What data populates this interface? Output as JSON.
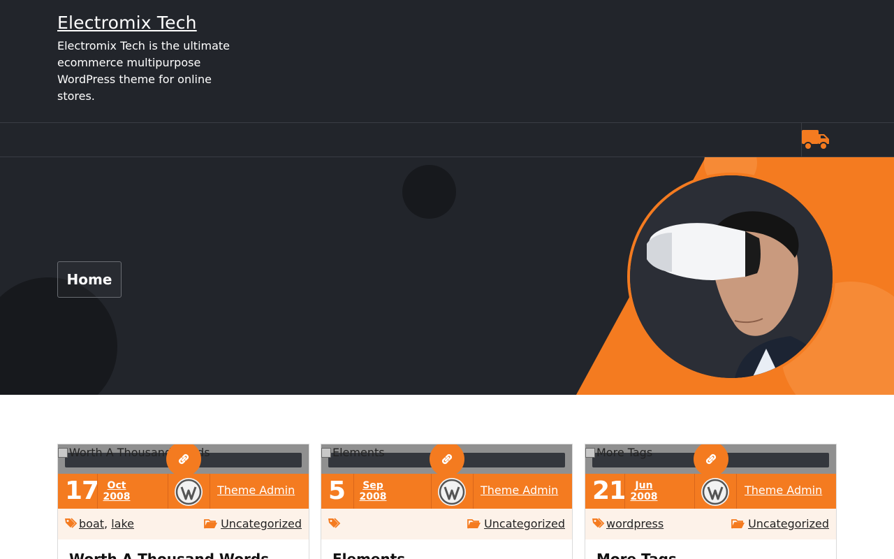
{
  "header": {
    "site_title": "Electromix Tech",
    "site_description": "Electromix Tech is the ultimate ecommerce multipurpose WordPress theme for online stores."
  },
  "nav": {
    "truck_icon": "truck-icon"
  },
  "hero": {
    "home_label": "Home"
  },
  "colors": {
    "accent": "#f47b20",
    "dark": "#22252b"
  },
  "posts": [
    {
      "thumb_alt": "Worth A Thousand Words",
      "day": "17",
      "month": "Oct",
      "year": "2008",
      "author": "Theme Admin",
      "tags": [
        "boat",
        "lake"
      ],
      "category": "Uncategorized",
      "title": "Worth A Thousand Words"
    },
    {
      "thumb_alt": "Elements",
      "day": "5",
      "month": "Sep",
      "year": "2008",
      "author": "Theme Admin",
      "tags": [],
      "category": "Uncategorized",
      "title": "Elements"
    },
    {
      "thumb_alt": "More Tags",
      "day": "21",
      "month": "Jun",
      "year": "2008",
      "author": "Theme Admin",
      "tags": [
        "wordpress"
      ],
      "category": "Uncategorized",
      "title": "More Tags"
    }
  ]
}
